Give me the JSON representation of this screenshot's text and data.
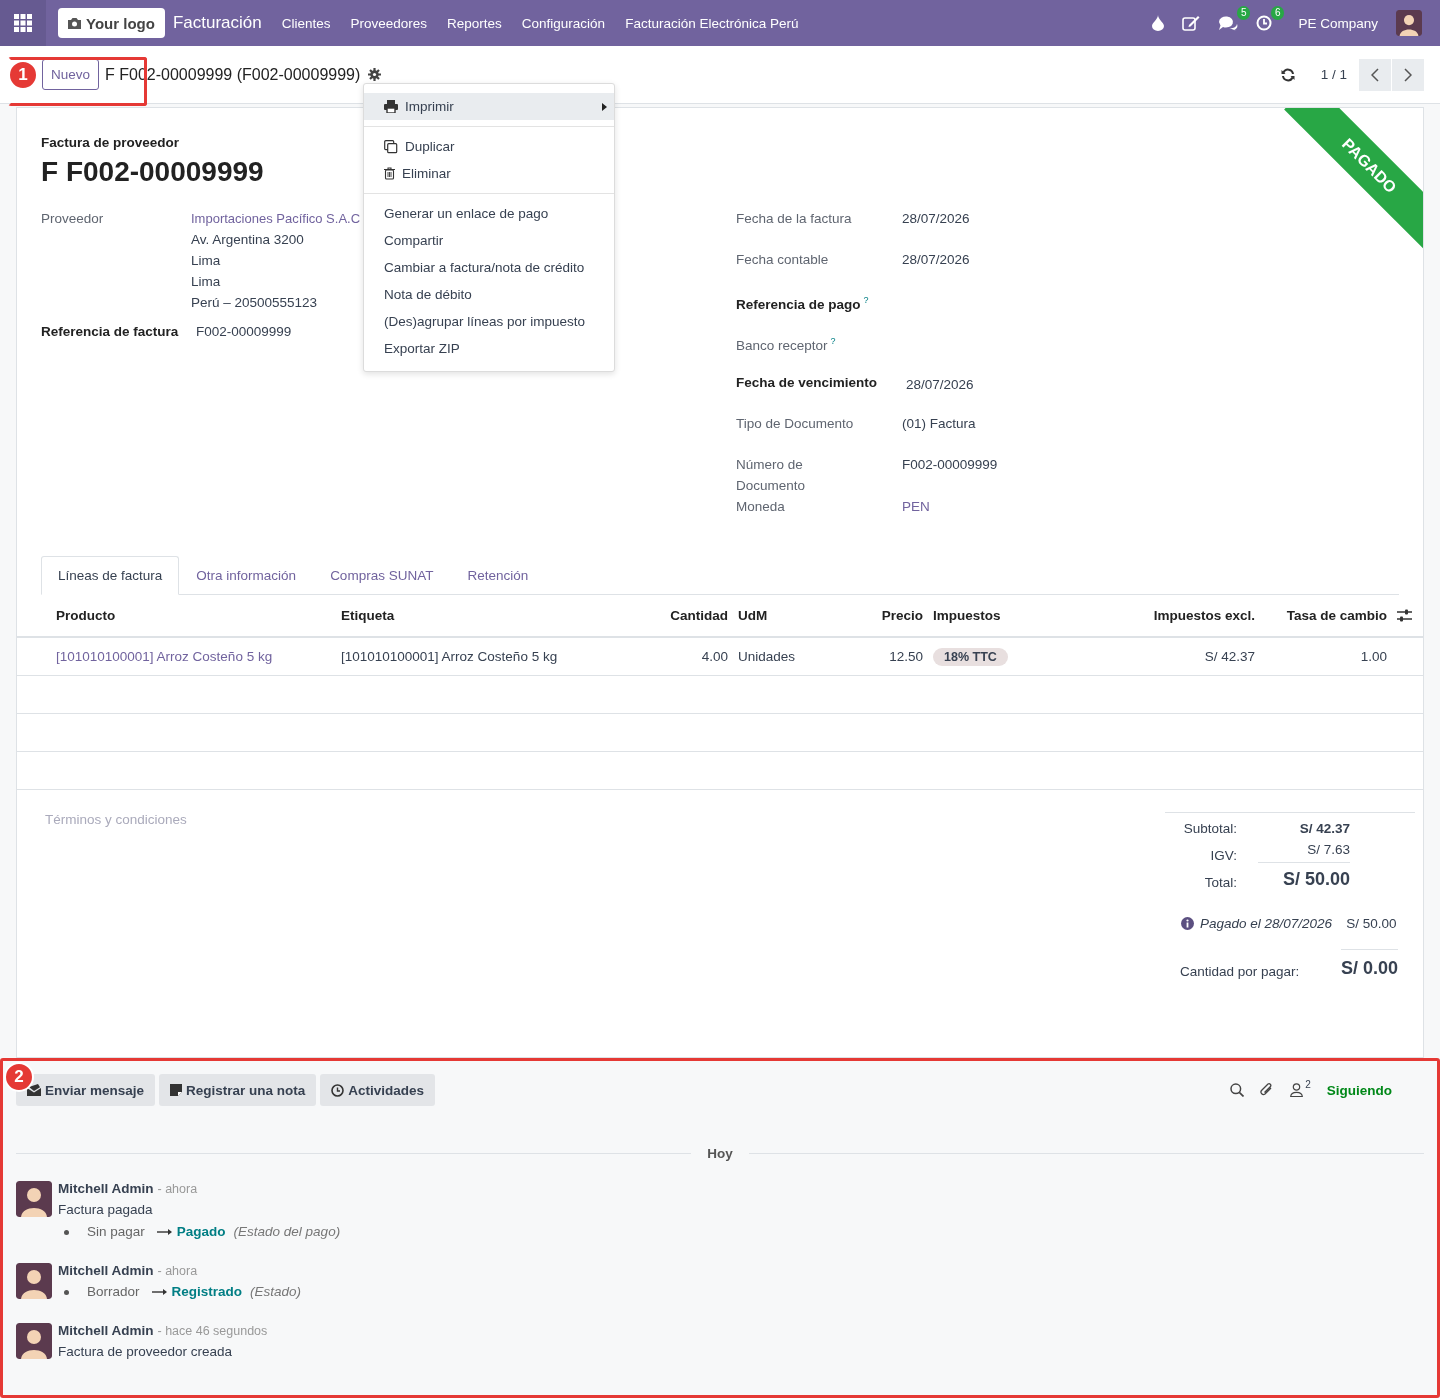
{
  "navbar": {
    "logo": "Your logo",
    "app": "Facturación",
    "menus": [
      "Clientes",
      "Proveedores",
      "Reportes",
      "Configuración",
      "Facturación Electrónica Perú"
    ],
    "messages_count": "5",
    "activities_count": "6",
    "company": "PE Company"
  },
  "control_panel": {
    "new_button": "Nuevo",
    "breadcrumb": "F F002-00009999 (F002-00009999)",
    "pager": "1 / 1"
  },
  "action_menu": {
    "sections": [
      [
        {
          "kind": "print",
          "label": "Imprimir",
          "highlighted": true
        }
      ],
      [
        {
          "kind": "duplicate",
          "label": "Duplicar",
          "highlighted": false
        },
        {
          "kind": "delete",
          "label": "Eliminar",
          "highlighted": false
        }
      ],
      [
        {
          "kind": "plain",
          "label": "Generar un enlace de pago",
          "highlighted": false
        },
        {
          "kind": "plain",
          "label": "Compartir",
          "highlighted": false
        },
        {
          "kind": "plain",
          "label": "Cambiar a factura/nota de crédito",
          "highlighted": false
        },
        {
          "kind": "plain",
          "label": "Nota de débito",
          "highlighted": false
        },
        {
          "kind": "plain",
          "label": "(Des)agrupar líneas por impuesto",
          "highlighted": false
        },
        {
          "kind": "plain",
          "label": "Exportar ZIP",
          "highlighted": false
        }
      ]
    ]
  },
  "sheet": {
    "ribbon": "PAGADO",
    "document_type": "Factura de proveedor",
    "title": "F F002-00009999",
    "left_fields": [
      {
        "label": "Proveedor",
        "required": false,
        "link": "Importaciones Pacífico S.A.C",
        "lines": [
          "Av. Argentina 3200",
          "Lima",
          "Lima",
          "Perú – 20500555123"
        ]
      },
      {
        "label": "Referencia de factura",
        "required": true,
        "value": "F002-00009999"
      }
    ],
    "right_fields": [
      {
        "label": "Fecha de la factura",
        "required": false,
        "value": "28/07/2026"
      },
      {
        "label": "Fecha contable",
        "required": false,
        "value": "28/07/2026"
      },
      {
        "label": "Referencia de pago",
        "required": true,
        "help": "?"
      },
      {
        "label": "Banco receptor",
        "required": false,
        "help": "?"
      },
      {
        "label": "Fecha de vencimiento",
        "required": true,
        "value": "28/07/2026"
      },
      {
        "label": "Tipo de Documento",
        "required": false,
        "value": "(01) Factura"
      },
      {
        "label": "Número de Documento",
        "required": false,
        "value": "F002-00009999"
      },
      {
        "label": "Moneda",
        "required": false,
        "value": "PEN",
        "is_link": true
      }
    ],
    "tabs": [
      {
        "label": "Líneas de factura",
        "selected": true
      },
      {
        "label": "Otra información",
        "selected": false
      },
      {
        "label": "Compras SUNAT",
        "selected": false
      },
      {
        "label": "Retención",
        "selected": false
      }
    ],
    "table": {
      "columns": [
        "Producto",
        "Etiqueta",
        "Cantidad",
        "UdM",
        "Precio",
        "Impuestos",
        "Impuestos excl.",
        "Tasa de cambio"
      ],
      "rows": [
        {
          "cells": [
            {
              "kind": "link",
              "text": "[101010100001] Arroz Costeño 5 kg"
            },
            {
              "kind": "text",
              "text": "[101010100001] Arroz Costeño 5 kg"
            },
            {
              "kind": "text",
              "text": "4.00"
            },
            {
              "kind": "text",
              "text": "Unidades"
            },
            {
              "kind": "text",
              "text": "12.50"
            },
            {
              "kind": "tag",
              "text": "18% TTC"
            },
            {
              "kind": "text",
              "text": "S/ 42.37"
            },
            {
              "kind": "text",
              "text": "1.00"
            }
          ]
        }
      ]
    },
    "terms_placeholder": "Términos y condiciones",
    "totals": [
      {
        "label": "Subtotal:",
        "value": "S/ 42.37",
        "kind": "bold"
      },
      {
        "label": "IGV:",
        "value": "S/ 7.63",
        "kind": "plain"
      },
      {
        "label": "Total:",
        "value": "S/ 50.00",
        "kind": "grand"
      }
    ],
    "payment": {
      "text": "Pagado el 28/07/2026",
      "amount": "S/ 50.00"
    },
    "amount_due": {
      "label": "Cantidad por pagar:",
      "value": "S/ 0.00"
    }
  },
  "chatter": {
    "buttons": [
      {
        "kind": "message",
        "label": "Enviar mensaje"
      },
      {
        "kind": "note",
        "label": "Registrar una nota"
      },
      {
        "kind": "activity",
        "label": "Actividades"
      }
    ],
    "followers_count": "2",
    "follow_label": "Siguiendo",
    "separator": "Hoy",
    "messages": [
      {
        "author": "Mitchell Admin",
        "time": "- ahora",
        "body": "Factura pagada",
        "changes": [
          {
            "old": "Sin pagar",
            "new": "Pagado",
            "field": "(Estado del pago)"
          }
        ]
      },
      {
        "author": "Mitchell Admin",
        "time": "- ahora",
        "changes": [
          {
            "old": "Borrador",
            "new": "Registrado",
            "field": "(Estado)"
          }
        ]
      },
      {
        "author": "Mitchell Admin",
        "time": "- hace 46 segundos",
        "body": "Factura de proveedor creada"
      }
    ]
  },
  "annotations": [
    {
      "number": "1"
    },
    {
      "number": "2"
    }
  ]
}
